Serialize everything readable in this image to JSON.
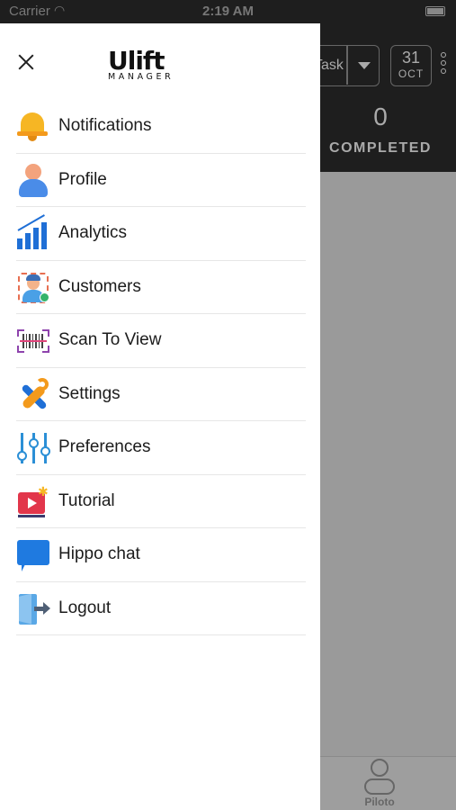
{
  "status_bar": {
    "carrier": "Carrier",
    "time": "2:19 AM"
  },
  "background_screen": {
    "task_select": "Task",
    "date": {
      "day": "31",
      "month": "OCT"
    },
    "completed_count": "0",
    "completed_label": "COMPLETED",
    "bottom_tab_label": "Piloto"
  },
  "drawer": {
    "logo": {
      "main": "Ulift",
      "sub": "MANAGER"
    },
    "menu": [
      {
        "label": "Notifications",
        "icon": "bell-icon"
      },
      {
        "label": "Profile",
        "icon": "profile-icon"
      },
      {
        "label": "Analytics",
        "icon": "analytics-icon"
      },
      {
        "label": "Customers",
        "icon": "customers-icon"
      },
      {
        "label": "Scan To View",
        "icon": "barcode-scan-icon"
      },
      {
        "label": "Settings",
        "icon": "wrench-screwdriver-icon"
      },
      {
        "label": "Preferences",
        "icon": "sliders-icon"
      },
      {
        "label": "Tutorial",
        "icon": "video-tutorial-icon"
      },
      {
        "label": "Hippo chat",
        "icon": "chat-bubble-icon"
      },
      {
        "label": "Logout",
        "icon": "logout-door-icon"
      }
    ]
  }
}
